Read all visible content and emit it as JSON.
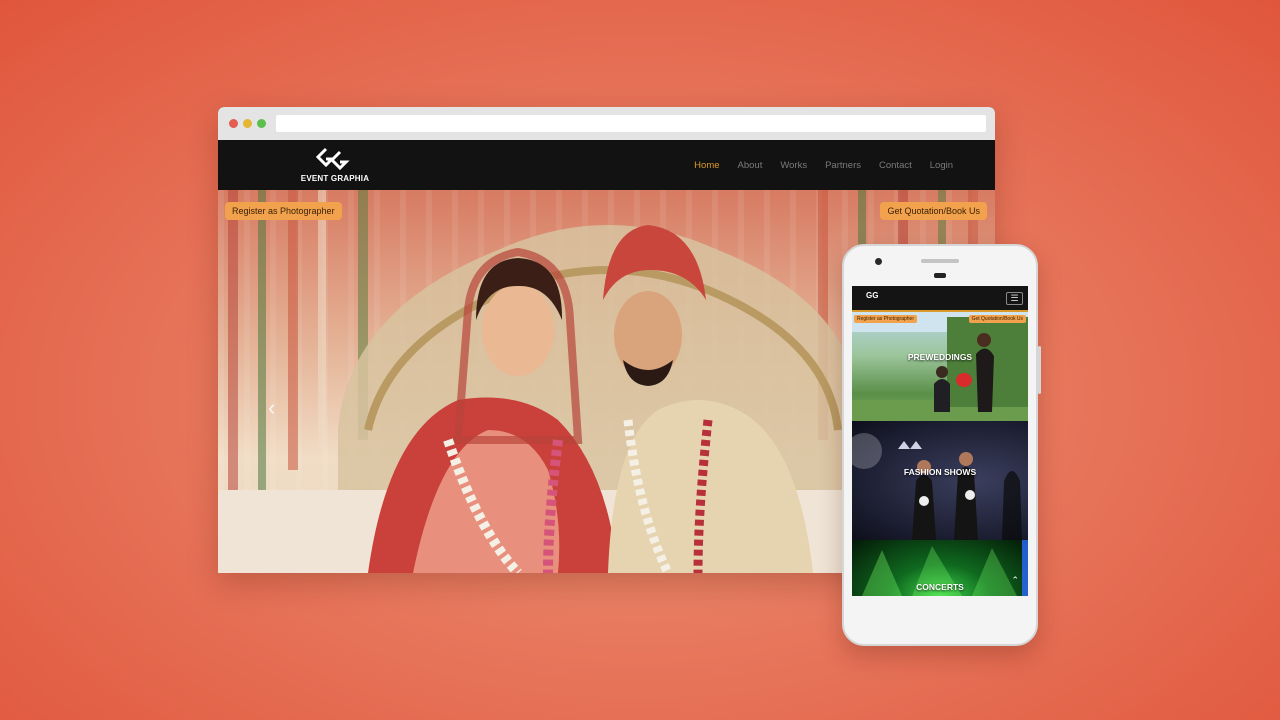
{
  "desktop": {
    "logo_text": "EVENT GRAPHIA",
    "nav": [
      "Home",
      "About",
      "Works",
      "Partners",
      "Contact",
      "Login"
    ],
    "active_nav": "Home",
    "buttons": {
      "register": "Register as Photographer",
      "quote": "Get Quotation/Book Us"
    },
    "carousel_prev": "‹"
  },
  "mobile": {
    "logo_text": "GG",
    "menu_icon": "☰",
    "buttons": {
      "register": "Register as Photographer",
      "quote": "Get Quotation/Book Us"
    },
    "sections": [
      "PREWEDDINGS",
      "FASHION SHOWS",
      "CONCERTS"
    ],
    "scroll_top": "⌃"
  },
  "colors": {
    "background": "#e0563c",
    "accent": "#d99a2b",
    "button": "#f2a24c"
  }
}
